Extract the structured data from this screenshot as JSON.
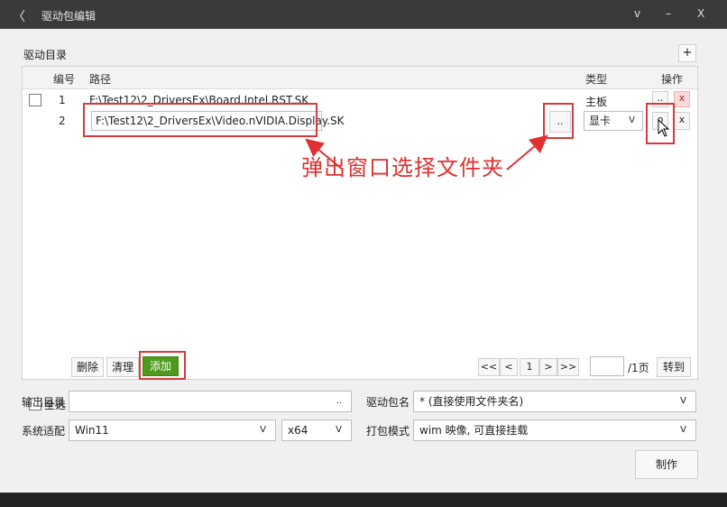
{
  "window": {
    "back_glyph": "〈",
    "title": "驱动包编辑",
    "chevron": "v",
    "minimize": "–",
    "close": "X"
  },
  "driver_dir": {
    "section_title": "驱动目录",
    "add_row_label": "+",
    "columns": {
      "index": "编号",
      "path": "路径",
      "type": "类型",
      "actions": "操作"
    },
    "rows": [
      {
        "index": "1",
        "path": "F:\\Test12\\2_DriversEx\\Board.Intel.RST.SK",
        "type": "主板",
        "browse": "..",
        "delete": "x"
      },
      {
        "index": "2",
        "path": "F:\\Test12\\2_DriversEx\\Video.nVIDIA.Display.SK",
        "browse": "..",
        "type": "显卡",
        "type_arrow": "V",
        "confirm": "o",
        "delete": "x"
      }
    ],
    "annotation": "弹出窗口选择文件夹",
    "footer": {
      "select_all": "全选",
      "delete": "删除",
      "clear": "清理",
      "add": "添加"
    },
    "pager": {
      "first": "<<",
      "prev": "<",
      "current": "1",
      "next": ">",
      "last": ">>",
      "total": "/1页",
      "goto": "转到"
    }
  },
  "settings": {
    "output_dir_label": "输出目录",
    "output_dir_btn": "..",
    "package_name_label": "驱动包名",
    "package_name_value": "* (直接使用文件夹名)",
    "system_label": "系统适配",
    "system_value": "Win11",
    "arch_value": "x64",
    "pack_mode_label": "打包模式",
    "pack_mode_value": "wim 映像, 可直接挂载",
    "make_label": "制作"
  },
  "colors": {
    "accent_green": "#4f9a1d",
    "highlight_red": "#d83a3a",
    "annotation_red": "#e03030"
  }
}
